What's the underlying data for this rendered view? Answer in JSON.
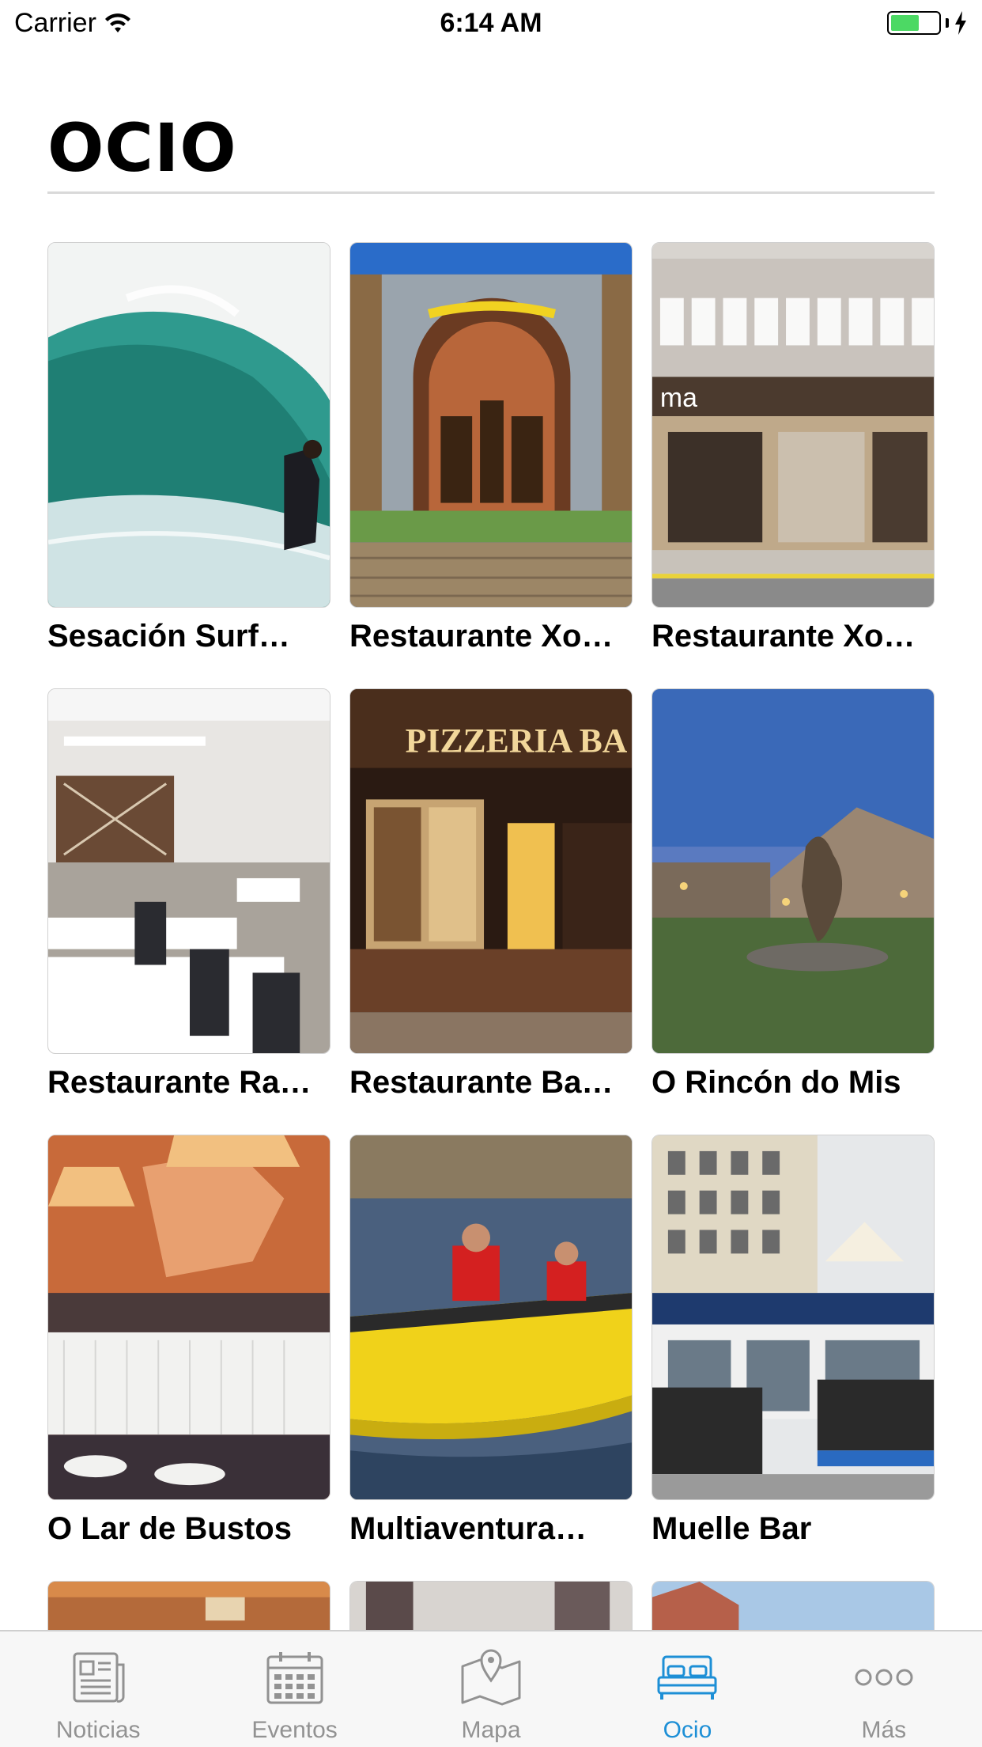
{
  "status_bar": {
    "carrier": "Carrier",
    "time": "6:14 AM"
  },
  "page": {
    "title": "OCIO"
  },
  "items": [
    {
      "label": "Sesación Surf…",
      "image": "wave-surfer-photo"
    },
    {
      "label": "Restaurante Xo…",
      "image": "stone-building-arched-doors-photo"
    },
    {
      "label": "Restaurante Xo…",
      "image": "restaurant-storefront-photo"
    },
    {
      "label": "Restaurante Ra…",
      "image": "dining-room-tables-photo"
    },
    {
      "label": "Restaurante Ba…",
      "image": "pizzeria-neon-sign-photo"
    },
    {
      "label": "O Rincón do Mis",
      "image": "stone-house-sculpture-dusk-photo"
    },
    {
      "label": "O Lar de Bustos",
      "image": "restaurant-interior-lamps-photo"
    },
    {
      "label": "Multiaventura…",
      "image": "yellow-speedboat-photo"
    },
    {
      "label": "Muelle Bar",
      "image": "harbor-bar-terrace-photo"
    }
  ],
  "tab_bar": {
    "tabs": [
      {
        "label": "Noticias",
        "icon": "newspaper-icon",
        "active": false
      },
      {
        "label": "Eventos",
        "icon": "calendar-icon",
        "active": false
      },
      {
        "label": "Mapa",
        "icon": "map-pin-icon",
        "active": false
      },
      {
        "label": "Ocio",
        "icon": "bed-icon",
        "active": true
      },
      {
        "label": "Más",
        "icon": "more-dots-icon",
        "active": false
      }
    ]
  },
  "colors": {
    "accent": "#1d8fd6",
    "inactive_tab": "#929292",
    "battery": "#4cd964"
  }
}
